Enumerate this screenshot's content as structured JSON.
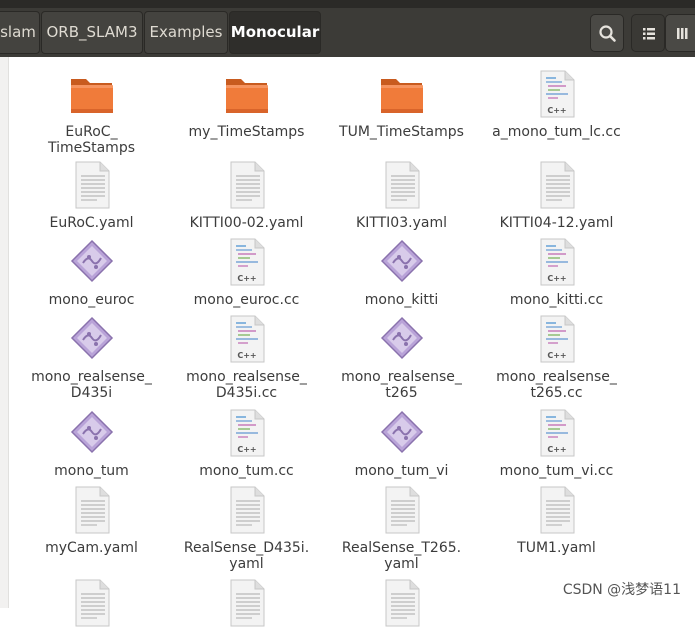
{
  "breadcrumbs": [
    "slam",
    "ORB_SLAM3",
    "Examples",
    "Monocular"
  ],
  "header_icons": [
    "search-icon",
    "list-view-icon",
    "grid-view-icon"
  ],
  "items": [
    {
      "label": "EuRoC_\nTimeStamps",
      "kind": "folder"
    },
    {
      "label": "my_TimeStamps",
      "kind": "folder"
    },
    {
      "label": "TUM_TimeStamps",
      "kind": "folder"
    },
    {
      "label": "a_mono_tum_lc.cc",
      "kind": "cpp"
    },
    {
      "label": "EuRoC.yaml",
      "kind": "text"
    },
    {
      "label": "KITTI00-02.yaml",
      "kind": "text"
    },
    {
      "label": "KITTI03.yaml",
      "kind": "text"
    },
    {
      "label": "KITTI04-12.yaml",
      "kind": "text"
    },
    {
      "label": "mono_euroc",
      "kind": "exec"
    },
    {
      "label": "mono_euroc.cc",
      "kind": "cpp"
    },
    {
      "label": "mono_kitti",
      "kind": "exec"
    },
    {
      "label": "mono_kitti.cc",
      "kind": "cpp"
    },
    {
      "label": "mono_realsense_\nD435i",
      "kind": "exec"
    },
    {
      "label": "mono_realsense_\nD435i.cc",
      "kind": "cpp"
    },
    {
      "label": "mono_realsense_\nt265",
      "kind": "exec"
    },
    {
      "label": "mono_realsense_\nt265.cc",
      "kind": "cpp"
    },
    {
      "label": "mono_tum",
      "kind": "exec"
    },
    {
      "label": "mono_tum.cc",
      "kind": "cpp"
    },
    {
      "label": "mono_tum_vi",
      "kind": "exec"
    },
    {
      "label": "mono_tum_vi.cc",
      "kind": "cpp"
    },
    {
      "label": "myCam.yaml",
      "kind": "text"
    },
    {
      "label": "RealSense_D435i.\nyaml",
      "kind": "text"
    },
    {
      "label": "RealSense_T265.\nyaml",
      "kind": "text"
    },
    {
      "label": "TUM1.yaml",
      "kind": "text"
    },
    {
      "label": "",
      "kind": "text"
    },
    {
      "label": "",
      "kind": "text"
    },
    {
      "label": "",
      "kind": "text"
    }
  ],
  "cpp_badge": "C++",
  "watermark": "CSDN @浅梦语11"
}
